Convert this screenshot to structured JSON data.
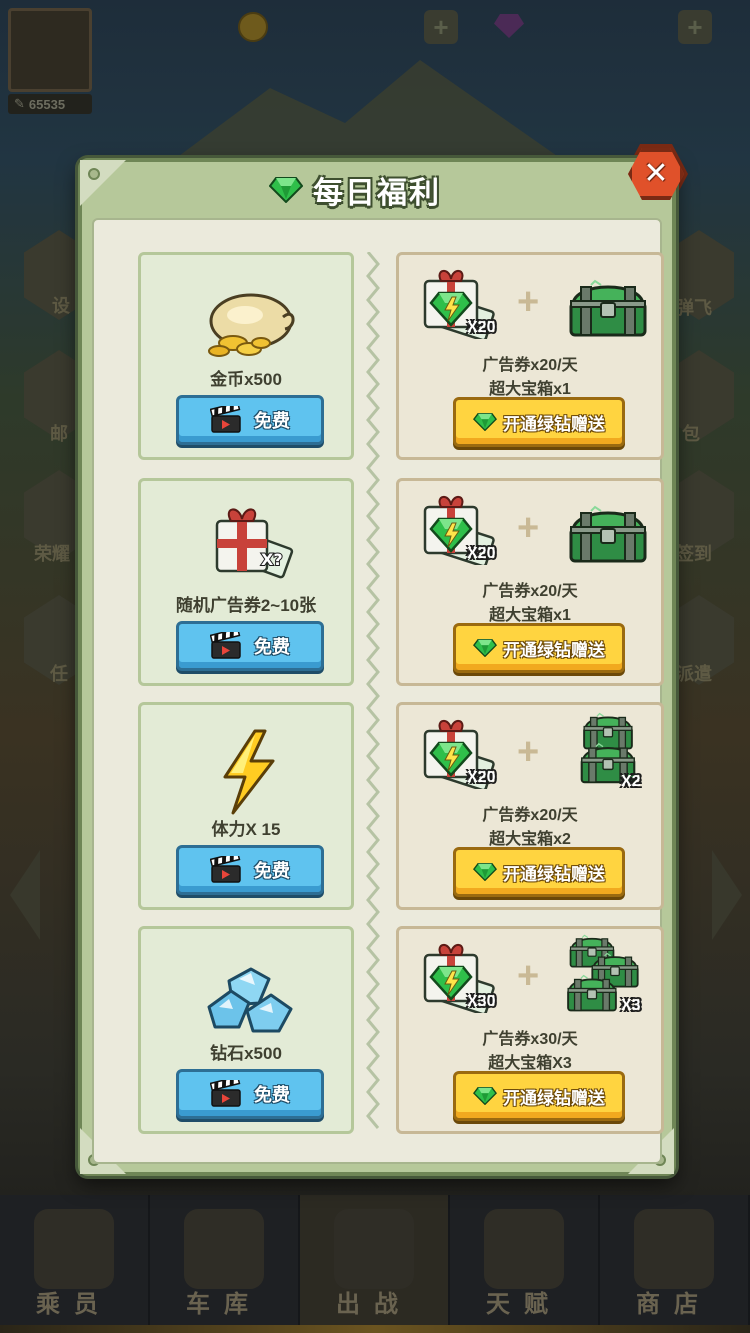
{
  "background": {
    "score": "65535",
    "side_labels_left": [
      "设",
      "邮",
      "荣耀",
      "任"
    ],
    "side_labels_right": [
      "弹飞",
      "包",
      "签到",
      "派遣"
    ],
    "nav": [
      {
        "label": "乘员",
        "active": false
      },
      {
        "label": "车库",
        "active": false
      },
      {
        "label": "出战",
        "active": true
      },
      {
        "label": "天赋",
        "active": false
      },
      {
        "label": "商店",
        "active": false
      }
    ]
  },
  "modal": {
    "title": "每日福利",
    "close_symbol": "✕",
    "title_icon": "green-diamond-icon",
    "accent_color": "#5fc3ef",
    "vip_color": "#ffd440"
  },
  "free_rewards": [
    {
      "label": "金币x500",
      "icon": "coin-bag-icon",
      "button": "免费"
    },
    {
      "label": "随机广告券2~10张",
      "icon": "ad-ticket-gift-icon",
      "button": "免费"
    },
    {
      "label": "体力X 15",
      "icon": "lightning-icon",
      "button": "免费"
    },
    {
      "label": "钻石x500",
      "icon": "diamond-pile-icon",
      "button": "免费"
    }
  ],
  "vip_rewards": [
    {
      "ticket_mult": "X20",
      "chest_mult": "",
      "line1": "广告券x20/天",
      "line2": "超大宝箱x1",
      "button": "开通绿钻赠送"
    },
    {
      "ticket_mult": "X20",
      "chest_mult": "",
      "line1": "广告券x20/天",
      "line2": "超大宝箱x1",
      "button": "开通绿钻赠送"
    },
    {
      "ticket_mult": "X20",
      "chest_mult": "X2",
      "line1": "广告券x20/天",
      "line2": "超大宝箱x2",
      "button": "开通绿钻赠送"
    },
    {
      "ticket_mult": "X30",
      "chest_mult": "X3",
      "line1": "广告券x30/天",
      "line2": "超大宝箱X3",
      "button": "开通绿钻赠送"
    }
  ]
}
